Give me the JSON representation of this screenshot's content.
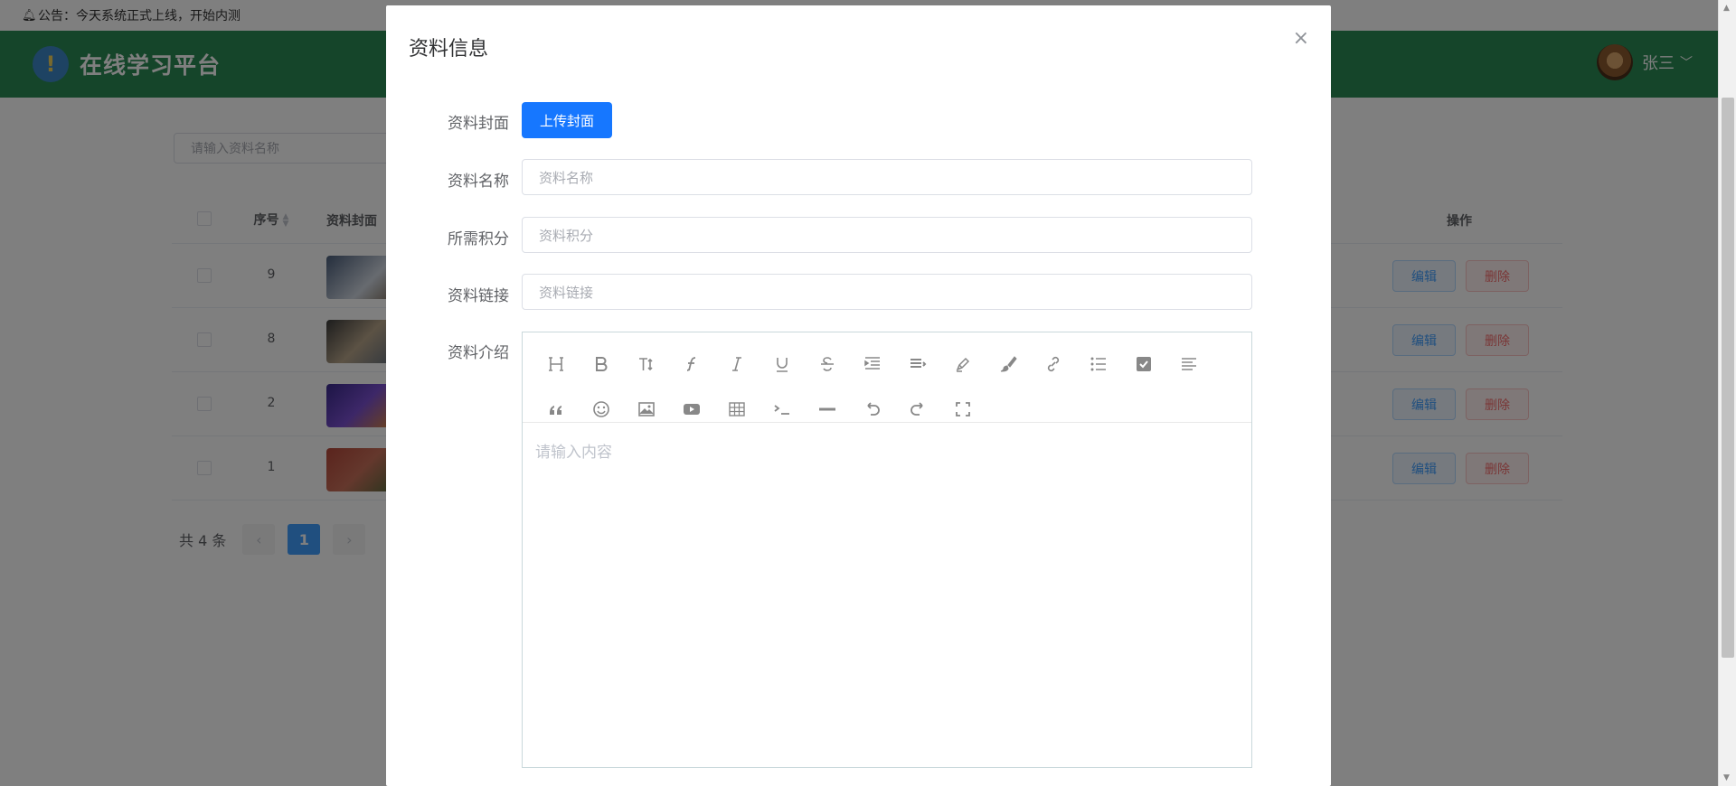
{
  "notice": {
    "text": "公告：今天系统正式上线，开始内测"
  },
  "header": {
    "title": "在线学习平台",
    "logo_glyph": "!",
    "user_name": "张三",
    "brand_color": "#2b8a54"
  },
  "search": {
    "placeholder": "请输入资料名称"
  },
  "table": {
    "headers": {
      "index": "序号",
      "cover": "资料封面",
      "ops": "操作"
    },
    "rows": [
      {
        "index": "9",
        "edit": "编辑",
        "delete": "删除"
      },
      {
        "index": "8",
        "edit": "编辑",
        "delete": "删除"
      },
      {
        "index": "2",
        "edit": "编辑",
        "delete": "删除"
      },
      {
        "index": "1",
        "edit": "编辑",
        "delete": "删除"
      }
    ]
  },
  "pager": {
    "total": "共 4 条",
    "current": "1",
    "prev": "‹",
    "next": "›"
  },
  "dialog": {
    "title": "资料信息",
    "close": "×",
    "fields": {
      "cover_label": "资料封面",
      "upload_label": "上传封面",
      "name_label": "资料名称",
      "name_placeholder": "资料名称",
      "score_label": "所需积分",
      "score_placeholder": "资料积分",
      "link_label": "资料链接",
      "link_placeholder": "资料链接",
      "intro_label": "资料介绍"
    },
    "editor": {
      "placeholder": "请输入内容",
      "toolbar_row1": [
        "heading-icon",
        "bold-icon",
        "font-size-icon",
        "font-family-icon",
        "italic-icon",
        "underline-icon",
        "strikethrough-icon",
        "indent-icon",
        "line-height-icon",
        "font-color-icon",
        "background-color-icon",
        "link-icon",
        "list-icon",
        "todo-icon",
        "justify-icon"
      ],
      "toolbar_row2": [
        "quote-icon",
        "emoji-icon",
        "image-icon",
        "video-icon",
        "table-icon",
        "code-icon",
        "divider-icon",
        "undo-icon",
        "redo-icon",
        "fullscreen-icon"
      ]
    },
    "accent_color": "#1677ff"
  }
}
